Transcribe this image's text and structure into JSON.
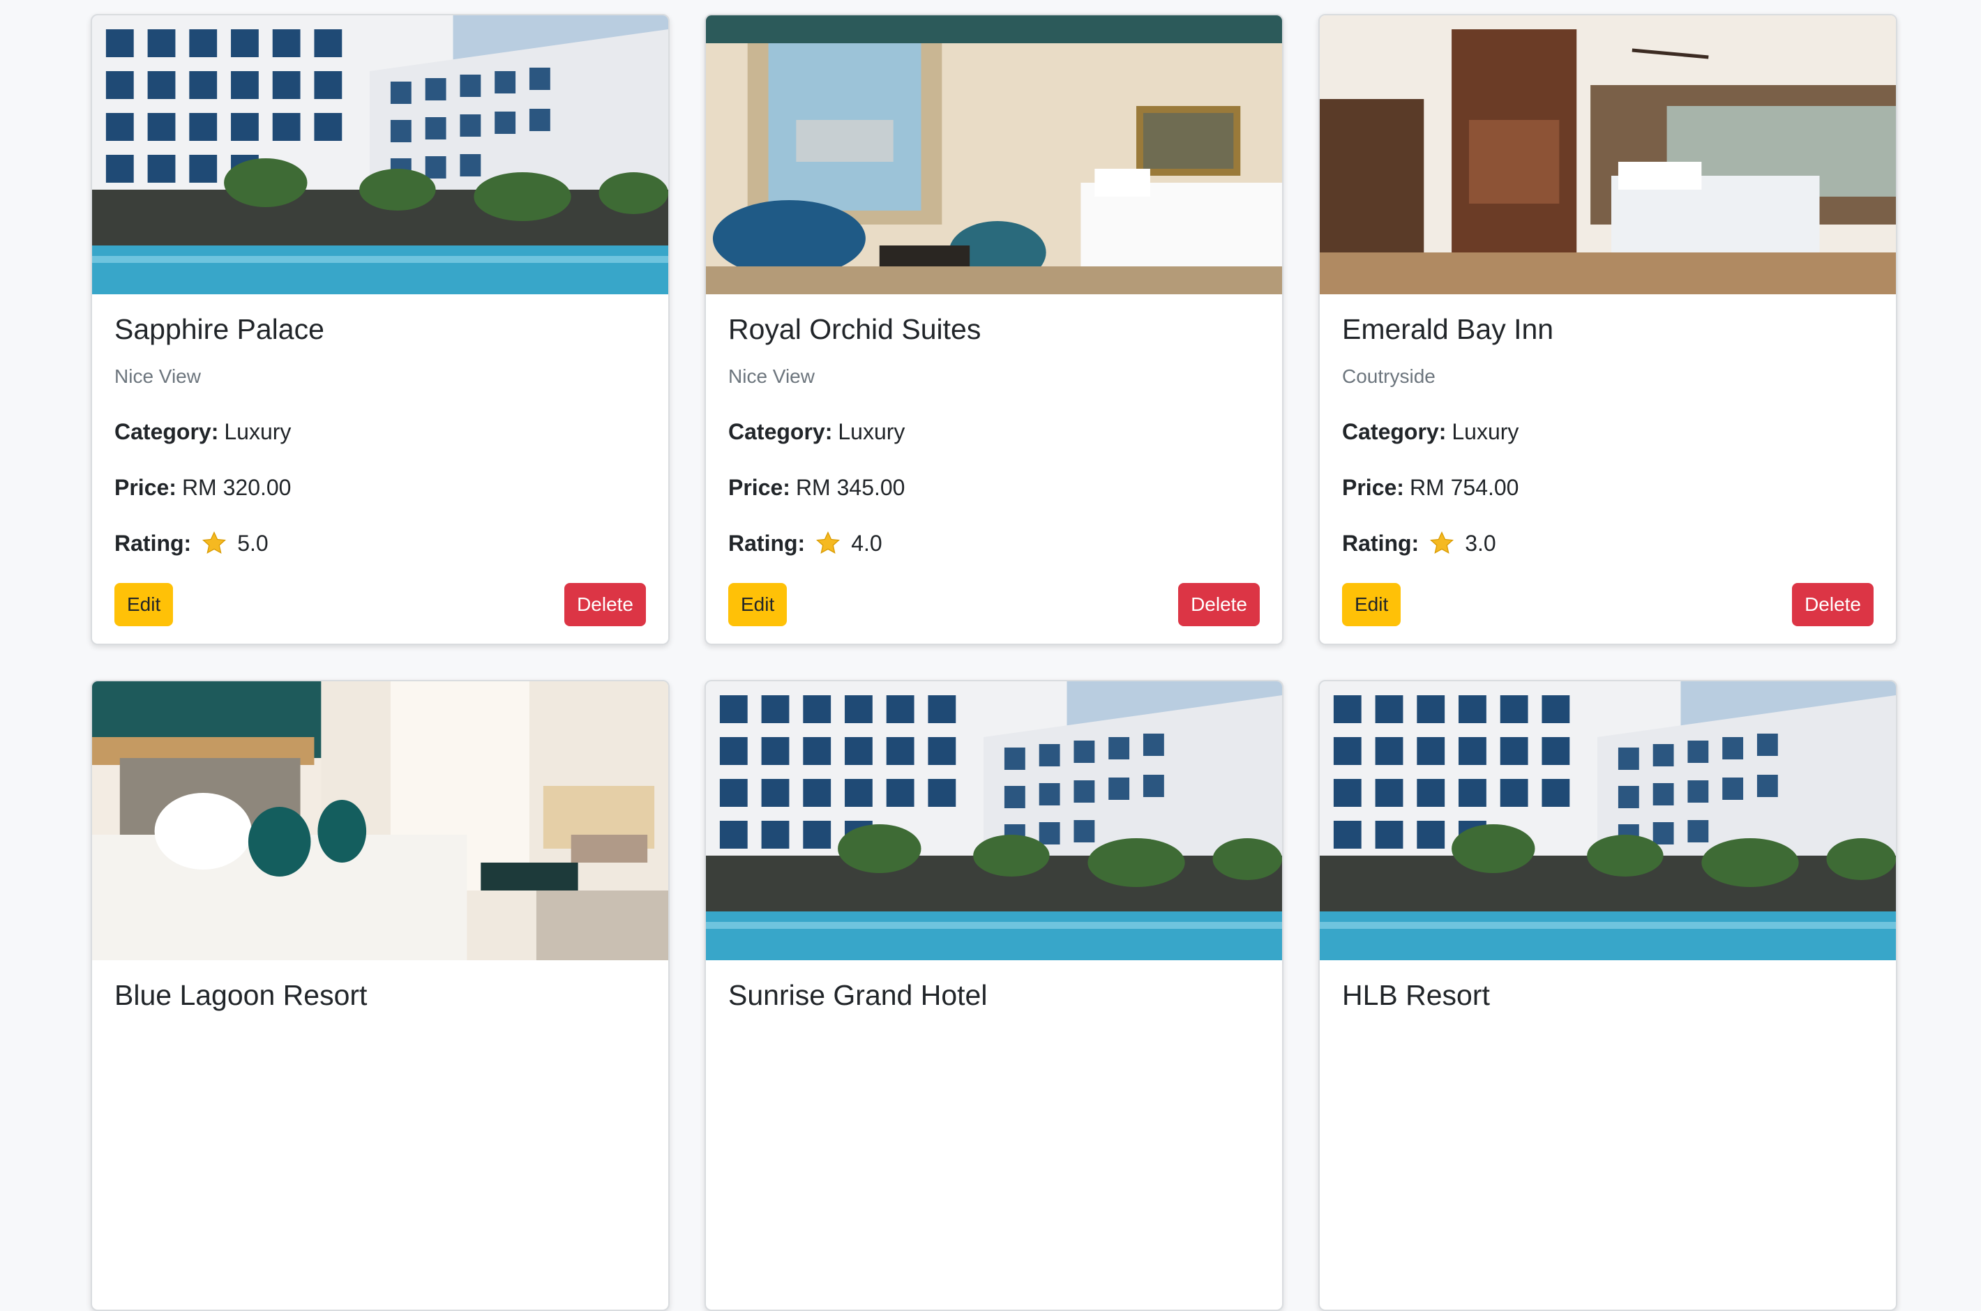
{
  "labels": {
    "category": "Category:",
    "price": "Price:",
    "rating": "Rating:",
    "edit": "Edit",
    "delete": "Delete"
  },
  "icons": {
    "rating": "star-icon"
  },
  "colors": {
    "edit": "#ffc107",
    "delete": "#dc3545",
    "star": "#f5b921"
  },
  "hotels": [
    {
      "name": "Sapphire Palace",
      "subtitle": "Nice View",
      "category": "Luxury",
      "price": "RM 320.00",
      "rating": "5.0",
      "image": "hotel-exterior-pool"
    },
    {
      "name": "Royal Orchid Suites",
      "subtitle": "Nice View",
      "category": "Luxury",
      "price": "RM 345.00",
      "rating": "4.0",
      "image": "luxury-bedroom-window"
    },
    {
      "name": "Emerald Bay Inn",
      "subtitle": "Coutryside",
      "category": "Luxury",
      "price": "RM 754.00",
      "rating": "3.0",
      "image": "wood-panel-bedroom"
    },
    {
      "name": "Blue Lagoon Resort",
      "image": "modern-bedroom-teal-pillows"
    },
    {
      "name": "Sunrise Grand Hotel",
      "image": "hotel-exterior-pool"
    },
    {
      "name": "HLB Resort",
      "image": "hotel-exterior-pool"
    }
  ]
}
